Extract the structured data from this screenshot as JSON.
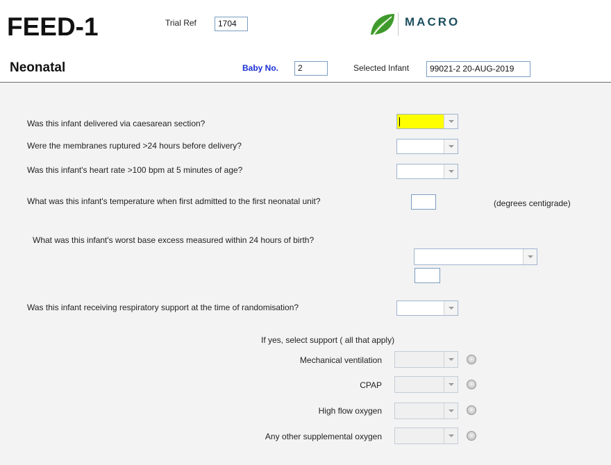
{
  "header": {
    "app_title": "FEED-1",
    "trial_ref_label": "Trial Ref",
    "trial_ref_value": "1704",
    "logo_text": "MACRO",
    "section_title": "Neonatal",
    "baby_no_label": "Baby No.",
    "baby_no_value": "2",
    "selected_infant_label": "Selected Infant",
    "selected_infant_value": "99021-2 20-AUG-2019"
  },
  "questions": {
    "caesarean": {
      "label": "Was this infant delivered via caesarean section?",
      "value": ""
    },
    "membranes": {
      "label": "Were the membranes ruptured >24 hours before delivery?",
      "value": ""
    },
    "heart_rate": {
      "label": "Was this infant's heart rate >100 bpm at 5 minutes of age?",
      "value": ""
    },
    "temperature": {
      "label": "What was this infant's temperature when first admitted to the first neonatal unit?",
      "value": "",
      "unit": "(degrees centigrade)"
    },
    "base_excess": {
      "label": "What was this infant's worst base excess measured within 24 hours of birth?",
      "select_value": "",
      "text_value": ""
    },
    "resp_support": {
      "label": "Was this infant receiving respiratory support at the time of randomisation?",
      "value": ""
    }
  },
  "support": {
    "header": "If yes, select support ( all that apply)",
    "items": [
      {
        "label": "Mechanical ventilation",
        "value": ""
      },
      {
        "label": "CPAP",
        "value": ""
      },
      {
        "label": "High flow oxygen",
        "value": ""
      },
      {
        "label": "Any other supplemental oxygen",
        "value": ""
      }
    ]
  },
  "colors": {
    "highlight": "#ffff00",
    "baby_no_label": "#1a2fd6",
    "form_background": "#f3f3f3",
    "logo_leaf": "#3f9a2c",
    "logo_text": "#1d4f5f"
  },
  "icons": {
    "logo": "leaf-logo-icon",
    "dropdown": "chevron-down-icon",
    "radio": "radio-button-icon"
  }
}
